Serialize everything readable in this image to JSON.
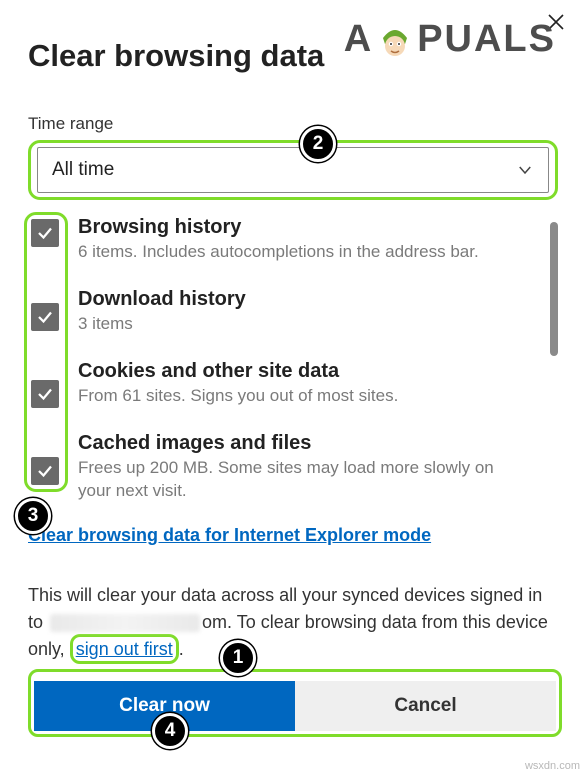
{
  "header": {
    "title": "Clear browsing data",
    "logo_left": "A",
    "logo_right": "PUALS"
  },
  "time_range": {
    "label": "Time range",
    "value": "All time"
  },
  "options": [
    {
      "name": "Browsing history",
      "desc": "6 items. Includes autocompletions in the address bar."
    },
    {
      "name": "Download history",
      "desc": "3 items"
    },
    {
      "name": "Cookies and other site data",
      "desc": "From 61 sites. Signs you out of most sites."
    },
    {
      "name": "Cached images and files",
      "desc": "Frees up 200 MB. Some sites may load more slowly on your next visit."
    }
  ],
  "ie_link": "Clear browsing data for Internet Explorer mode",
  "sync_text": {
    "pre": "This will clear your data across all your synced devices signed in to ",
    "mid": "om. To clear browsing data from this device only, ",
    "link": "sign out first",
    "post": "."
  },
  "buttons": {
    "primary": "Clear now",
    "secondary": "Cancel"
  },
  "annotations": {
    "b1": "1",
    "b2": "2",
    "b3": "3",
    "b4": "4"
  },
  "watermark": "wsxdn.com"
}
